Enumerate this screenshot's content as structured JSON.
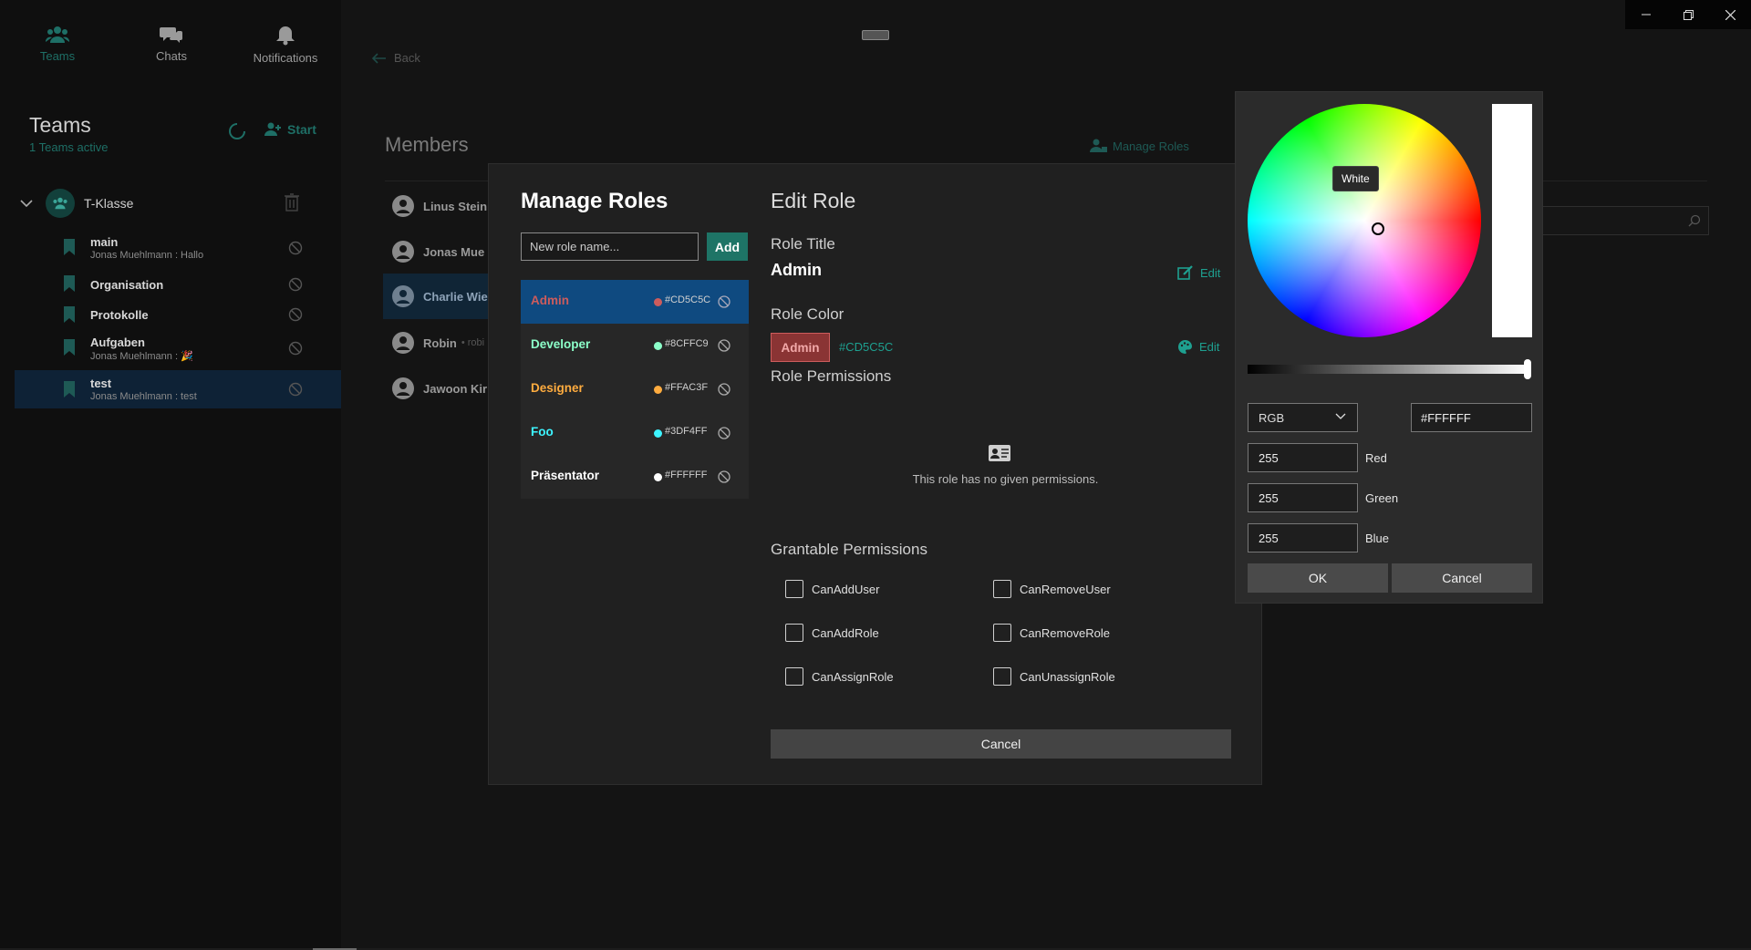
{
  "nav": {
    "tabs": [
      {
        "label": "Teams",
        "icon": "people-icon",
        "active": true
      },
      {
        "label": "Chats",
        "icon": "chat-bubbles-icon",
        "active": false
      },
      {
        "label": "Notifications",
        "icon": "bell-icon",
        "active": false
      }
    ]
  },
  "sidebar": {
    "title": "Teams",
    "subtitle": "1 Teams active",
    "start_label": "Start",
    "team": {
      "name": "T-Klasse"
    },
    "channels": [
      {
        "name": "main",
        "last": "Jonas Muehlmann : Hallo"
      },
      {
        "name": "Organisation",
        "last": ""
      },
      {
        "name": "Protokolle",
        "last": ""
      },
      {
        "name": "Aufgaben",
        "last": "Jonas Muehlmann : 🎉"
      },
      {
        "name": "test",
        "last": "Jonas Muehlmann : test"
      }
    ]
  },
  "main": {
    "back_label": "Back",
    "members_title": "Members",
    "manage_roles_label": "Manage Roles",
    "members": [
      {
        "name": "Linus Stein"
      },
      {
        "name": "Jonas Mue"
      },
      {
        "name": "Charlie Wie"
      },
      {
        "name": "Robin",
        "extra": "• robi"
      },
      {
        "name": "Jawoon Kir"
      }
    ]
  },
  "dialog": {
    "title": "Manage Roles",
    "new_role_placeholder": "New role name...",
    "add_label": "Add",
    "roles": [
      {
        "name": "Admin",
        "hex": "#CD5C5C",
        "color": "#CD5C5C",
        "selected": true
      },
      {
        "name": "Developer",
        "hex": "#8CFFC9",
        "color": "#8CFFC9",
        "selected": false
      },
      {
        "name": "Designer",
        "hex": "#FFAC3F",
        "color": "#FFAC3F",
        "selected": false
      },
      {
        "name": "Foo",
        "hex": "#3DF4FF",
        "color": "#3DF4FF",
        "selected": false
      },
      {
        "name": "Präsentator",
        "hex": "#FFFFFF",
        "color": "#FFFFFF",
        "selected": false
      }
    ],
    "edit_role_title": "Edit Role",
    "role_title_label": "Role Title",
    "role_title_value": "Admin",
    "edit_label": "Edit",
    "role_color_label": "Role Color",
    "role_color_badge": "Admin",
    "role_color_hex": "#CD5C5C",
    "role_permissions_label": "Role Permissions",
    "no_permissions_text": "This role has no given permissions.",
    "grantable_label": "Grantable Permissions",
    "permissions": [
      "CanAddUser",
      "CanRemoveUser",
      "CanAddRole",
      "CanRemoveRole",
      "CanAssignRole",
      "CanUnassignRole"
    ],
    "cancel_label": "Cancel"
  },
  "picker": {
    "tooltip": "White",
    "mode": "RGB",
    "hex": "#FFFFFF",
    "red": "255",
    "green": "255",
    "blue": "255",
    "red_label": "Red",
    "green_label": "Green",
    "blue_label": "Blue",
    "ok_label": "OK",
    "cancel_label": "Cancel",
    "brightness": 1.0
  },
  "colors": {
    "accent": "#1E7466",
    "selection": "#0F4A80"
  }
}
